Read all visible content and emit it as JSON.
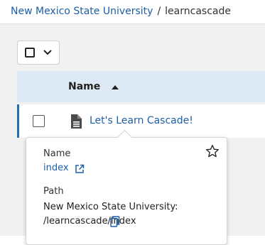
{
  "breadcrumb": {
    "site": "New Mexico State University",
    "separator": "/",
    "current": "learncascade"
  },
  "table": {
    "column_name": "Name",
    "sort_direction": "ascending",
    "rows": [
      {
        "title": "Let's Learn Cascade!"
      }
    ]
  },
  "popover": {
    "name_label": "Name",
    "name_value": "index",
    "path_label": "Path",
    "path_value": "New Mexico State University: /learncascade/index"
  },
  "colors": {
    "link": "#1d5fa7",
    "header_bg": "#ddeaf5",
    "accent": "#1f6fb2",
    "page_bg": "#f1f1f1"
  }
}
